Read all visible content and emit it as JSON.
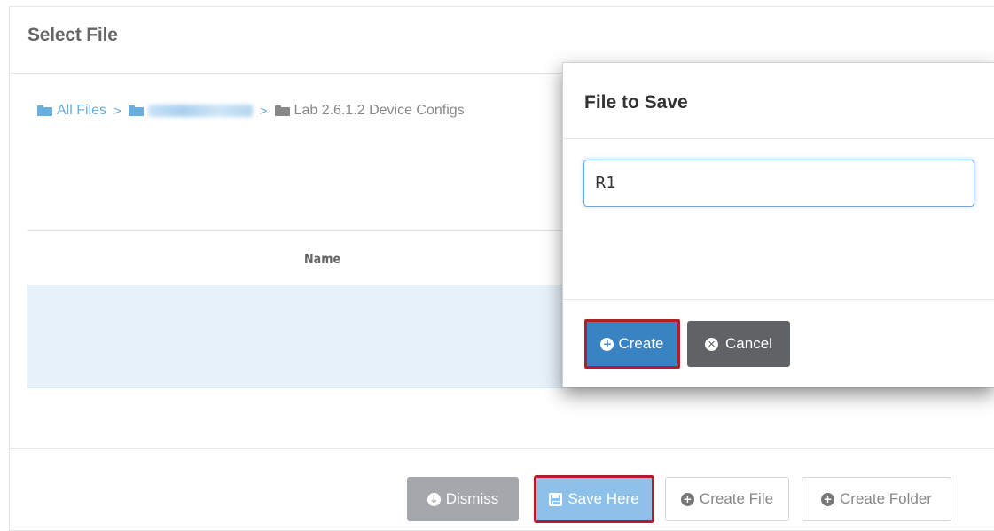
{
  "panel": {
    "title": "Select File",
    "breadcrumb": {
      "root": "All Files",
      "separator": ">",
      "current": "Lab 2.6.1.2 Device Configs"
    },
    "table": {
      "columns": [
        "Name"
      ]
    },
    "footer": {
      "dismiss_label": "Dismiss",
      "save_here_label": "Save Here",
      "create_file_label": "Create File",
      "create_folder_label": "Create Folder"
    }
  },
  "modal": {
    "title": "File to Save",
    "filename_value": "R1",
    "create_label": "Create",
    "cancel_label": "Cancel"
  },
  "colors": {
    "primary": "#3a83c3",
    "primary_light": "#8ec1ea",
    "highlight_border": "#b21d2a",
    "cancel_bg": "#5f6366",
    "dismiss_bg": "#a4a8ac",
    "link": "#6aaee0",
    "selected_row": "#e7f1fa"
  }
}
